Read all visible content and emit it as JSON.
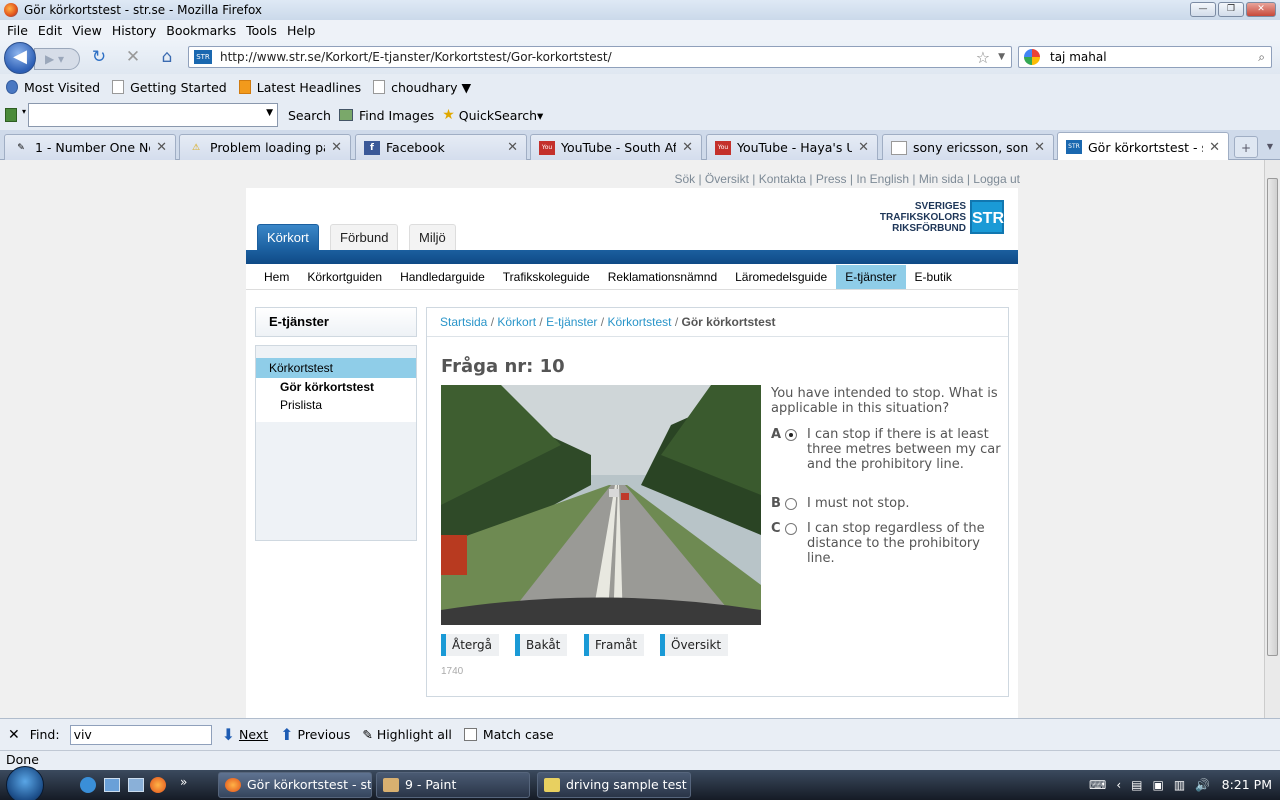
{
  "window": {
    "title": "Gör körkortstest - str.se - Mozilla Firefox"
  },
  "menu": [
    "File",
    "Edit",
    "View",
    "History",
    "Bookmarks",
    "Tools",
    "Help"
  ],
  "nav": {
    "url": "http://www.str.se/Korkort/E-tjanster/Korkortstest/Gor-korkortstest/",
    "search_value": "taj mahal"
  },
  "bookmarks": [
    "Most Visited",
    "Getting Started",
    "Latest Headlines",
    "choudhary ▼"
  ],
  "toolbar3": {
    "search": "Search",
    "find_images": "Find Images",
    "quicksearch": "QuickSearch▾"
  },
  "tabs": [
    {
      "label": "1 - Number One New..."
    },
    {
      "label": "Problem loading page"
    },
    {
      "label": "Facebook"
    },
    {
      "label": "YouTube - South Afri..."
    },
    {
      "label": "YouTube - Haya's Uf..."
    },
    {
      "label": "sony ericsson, sony e..."
    },
    {
      "label": "Gör körkortstest - s..."
    }
  ],
  "site": {
    "toplinks": "Sök |  Översikt |  Kontakta |  Press |  In English |  Min sida   |  Logga ut",
    "logo_lines": [
      "SVERIGES",
      "TRAFIKSKOLORS",
      "RIKSFÖRBUND"
    ],
    "logo_box": "STR",
    "main_tabs": [
      "Körkort",
      "Förbund",
      "Miljö"
    ],
    "subnav": [
      "Hem",
      "Körkortguiden",
      "Handledarguide",
      "Trafikskoleguide",
      "Reklamationsnämnd",
      "Läromedelsguide",
      "E-tjänster",
      "E-butik"
    ],
    "side_title": "E-tjänster",
    "side_items": [
      "Körkortstest",
      "Gör körkortstest",
      "Prislista"
    ],
    "breadcrumb": [
      "Startsida",
      "Körkort",
      "E-tjänster",
      "Körkortstest",
      "Gör körkortstest"
    ],
    "question_title": "Fråga nr: 10",
    "question_text": "You have intended to stop. What is applicable in this situation?",
    "options": [
      {
        "letter": "A",
        "text": "I can stop if there is at least three metres between my car and the prohibitory line.",
        "selected": true
      },
      {
        "letter": "B",
        "text": "I must not stop.",
        "selected": false
      },
      {
        "letter": "C",
        "text": "I can stop regardless of the distance to the prohibitory line.",
        "selected": false
      }
    ],
    "buttons": [
      "Återgå",
      "Bakåt",
      "Framåt",
      "Översikt"
    ],
    "question_code": "1740"
  },
  "findbar": {
    "label": "Find:",
    "value": "viv",
    "next": "Next",
    "previous": "Previous",
    "highlight": "Highlight all",
    "match_case": "Match case"
  },
  "status": "Done",
  "taskbar": {
    "items": [
      "Gör körkortstest - st...",
      "9 - Paint",
      "driving sample test"
    ],
    "clock": "8:21 PM"
  }
}
